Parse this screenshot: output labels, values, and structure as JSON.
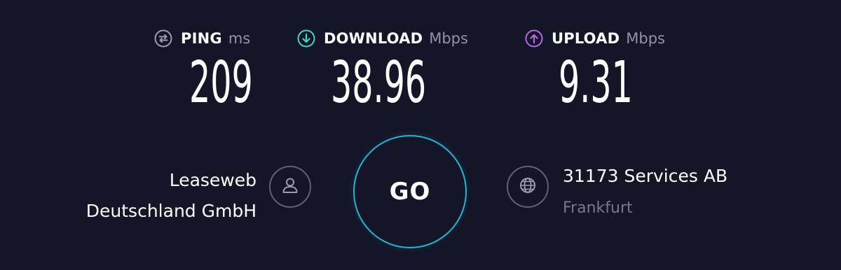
{
  "metrics": {
    "ping": {
      "label": "PING",
      "unit": "ms",
      "value": "209",
      "icon": "ping-icon",
      "color": "#9b9caf"
    },
    "download": {
      "label": "DOWNLOAD",
      "unit": "Mbps",
      "value": "38.96",
      "icon": "download-arrow-icon",
      "color": "#3ed4c8"
    },
    "upload": {
      "label": "UPLOAD",
      "unit": "Mbps",
      "value": "9.31",
      "icon": "upload-arrow-icon",
      "color": "#b565ea"
    }
  },
  "isp": {
    "name_line1": "Leaseweb",
    "name_line2": "Deutschland GmbH",
    "icon": "user-icon"
  },
  "go_button": {
    "label": "GO",
    "color": "#21b5d6"
  },
  "server": {
    "name": "31173 Services AB",
    "location": "Frankfurt",
    "icon": "globe-icon"
  },
  "colors": {
    "background": "#141526",
    "muted_text": "#9193a8",
    "location_text": "#76788e",
    "ring_border": "#5f6071"
  }
}
